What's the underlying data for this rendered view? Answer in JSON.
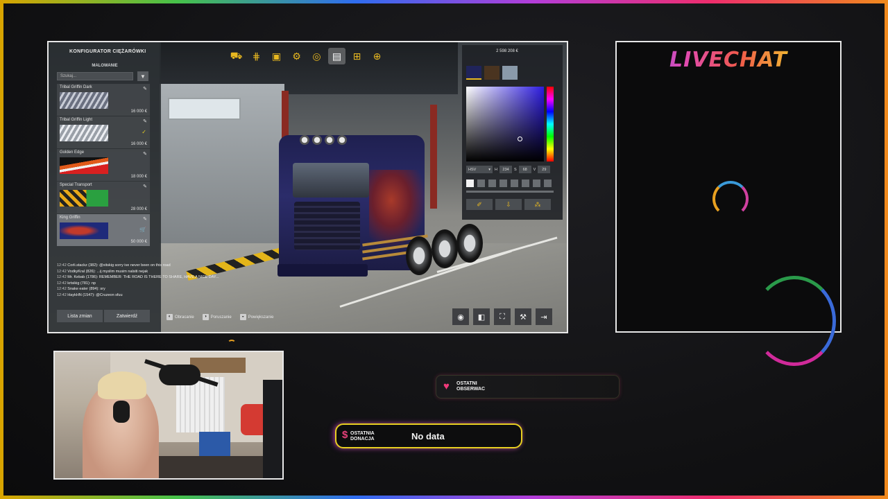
{
  "game": {
    "panel_title": "KONFIGURATOR CIĘŻARÓWKI",
    "section_title": "MALOWANIE",
    "search_placeholder": "Szukaj...",
    "paints": [
      {
        "name": "Tribal Griffin Dark",
        "price": "16 000 €",
        "status": ""
      },
      {
        "name": "Tribal Griffin Light",
        "price": "16 000 €",
        "status": "✓"
      },
      {
        "name": "Golden Edge",
        "price": "18 000 €",
        "status": ""
      },
      {
        "name": "Special Transport",
        "price": "28 000 €",
        "status": ""
      },
      {
        "name": "King Griffin",
        "price": "50 000 €",
        "status": "🛒"
      }
    ],
    "buttons": {
      "changes": "Lista zmian",
      "confirm": "Zatwierdź"
    },
    "hints": {
      "rotate": "Obracanie",
      "move": "Poruszanie",
      "zoom": "Powiększanie"
    },
    "money": "2 598 208 €",
    "color_mode": "HSV",
    "hsv": {
      "h_label": "H",
      "h": "234",
      "s_label": "S",
      "s": "68",
      "v_label": "V",
      "v": "29"
    },
    "chat": [
      {
        "time": "12:42",
        "text": "Corli.stackz (382): @xitskig sorry ive never been on this road"
      },
      {
        "time": "12:42",
        "text": "VodkyKral (826): ...ij myslim musim nalsiti nejak"
      },
      {
        "time": "12:42",
        "text": "Mr. Kebab (1786): REMEMBER: THE ROAD IS THERE TO SHARE, HAVE A NICE DAY..."
      },
      {
        "time": "12:42",
        "text": "krtsikig (781): np"
      },
      {
        "time": "12:42",
        "text": "Snake eater (894): sry"
      },
      {
        "time": "12:42",
        "text": "HaykHN (1547): @Cruzeon sfuu"
      }
    ]
  },
  "livechat": {
    "title": "LIVECHAT"
  },
  "alerts": {
    "follower_label_1": "OSTATNI",
    "follower_label_2": "OBSERWAC",
    "donation_label_1": "OSTATNIA",
    "donation_label_2": "DONACJA",
    "donation_value": "No data"
  },
  "colors": {
    "accent_yellow": "#e8b820",
    "heart_pink": "#f03a7a",
    "donation_border": "#e8d020"
  },
  "icons": [
    "filter-icon",
    "wrench-icon",
    "check-icon",
    "cart-icon",
    "heart-icon",
    "dollar-icon",
    "truck-icon",
    "color-picker-icon"
  ]
}
